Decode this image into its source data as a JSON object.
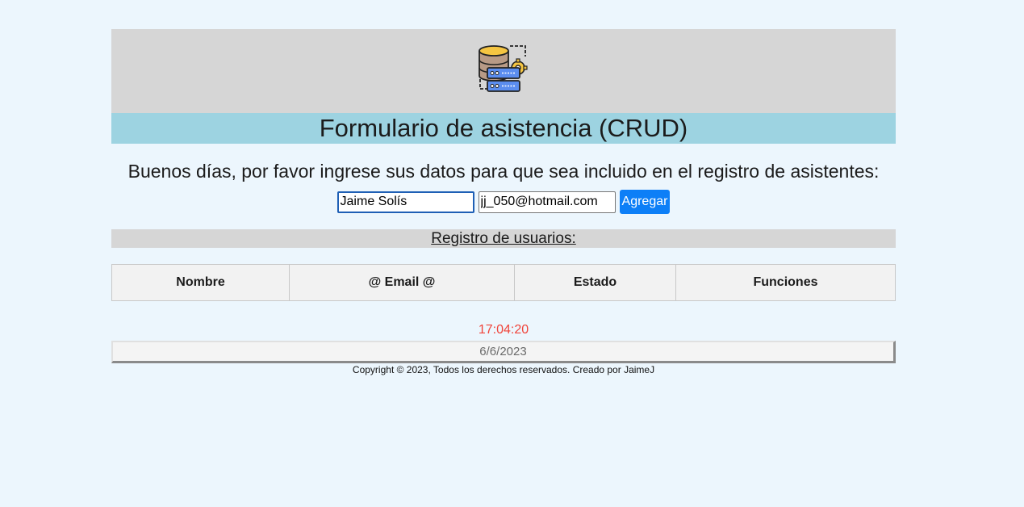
{
  "header": {
    "logo_icon": "database-server-gear-icon",
    "title": "Formulario de asistencia (CRUD)"
  },
  "greeting": "Buenos días, por favor ingrese sus datos para que sea incluido en el registro de asistentes:",
  "form": {
    "name_value": "Jaime Solís",
    "email_value": "jj_050@hotmail.com",
    "add_label": "Agregar"
  },
  "registry": {
    "title": "Registro de usuarios:",
    "columns": [
      "Nombre",
      "@ Email @",
      "Estado",
      "Funciones"
    ]
  },
  "footer": {
    "time": "17:04:20",
    "date": "6/6/2023",
    "copyright": "Copyright © 2023, Todos los derechos reservados. Creado por JaimeJ"
  },
  "colors": {
    "background": "#ecf6fd",
    "logo_band": "#d6d6d6",
    "title_band": "#9dd3e1",
    "button": "#0d7ff7",
    "clock": "#f0443a"
  }
}
